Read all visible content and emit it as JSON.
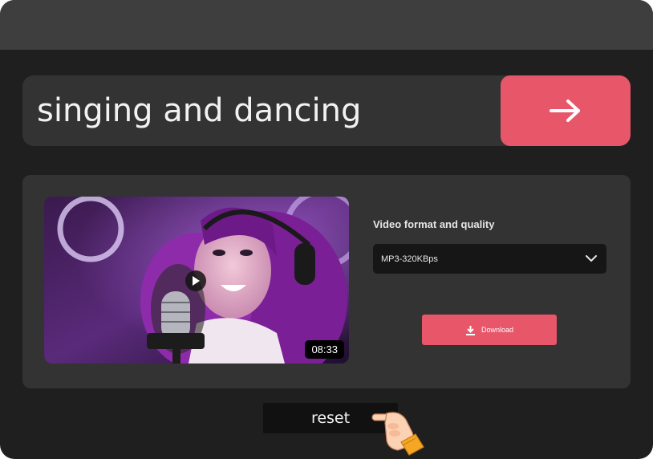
{
  "search": {
    "query": "singing and dancing"
  },
  "go_button": {
    "icon": "arrow-right-icon",
    "color": "#e8566a"
  },
  "video": {
    "duration": "08:33",
    "play_icon": "play-icon"
  },
  "format": {
    "label": "Video format and quality",
    "selected": "MP3-320KBps",
    "dropdown_icon": "chevron-down-icon"
  },
  "download": {
    "label": "Download",
    "icon": "download-icon",
    "color": "#e8566a"
  },
  "reset": {
    "label": "reset"
  },
  "pointer": {
    "icon": "pointing-hand-icon"
  }
}
